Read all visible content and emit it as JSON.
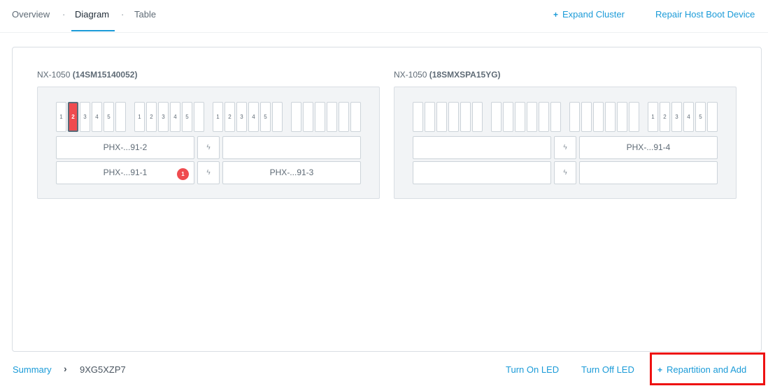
{
  "tabs": [
    {
      "label": "Overview",
      "active": false
    },
    {
      "label": "Diagram",
      "active": true
    },
    {
      "label": "Table",
      "active": false
    }
  ],
  "tab_separator": "·",
  "header_actions": {
    "expand_cluster_icon": "+",
    "expand_cluster": "Expand Cluster",
    "repair_host_boot": "Repair Host Boot Device"
  },
  "blocks": [
    {
      "model": "NX-1050",
      "serial": "(14SM15140052)",
      "disk_groups": [
        [
          "1",
          "2",
          "3",
          "4",
          "5",
          ""
        ],
        [
          "1",
          "2",
          "3",
          "4",
          "5",
          ""
        ],
        [
          "1",
          "2",
          "3",
          "4",
          "5",
          ""
        ],
        [
          "",
          "",
          "",
          "",
          "",
          ""
        ]
      ],
      "alert_disk": "2",
      "power_icon": "ϟ",
      "nodes": {
        "top_left": "PHX-...91-2",
        "top_right": "",
        "bottom_left": "PHX-...91-1",
        "bottom_right": "PHX-...91-3"
      },
      "alert_count": "1"
    },
    {
      "model": "NX-1050",
      "serial": "(18SMXSPA15YG)",
      "disk_groups": [
        [
          "",
          "",
          "",
          "",
          "",
          ""
        ],
        [
          "",
          "",
          "",
          "",
          "",
          ""
        ],
        [
          "",
          "",
          "",
          "",
          "",
          ""
        ],
        [
          "1",
          "2",
          "3",
          "4",
          "5",
          ""
        ]
      ],
      "power_icon": "ϟ",
      "nodes": {
        "top_left": "",
        "top_right": "PHX-...91-4",
        "bottom_left": "",
        "bottom_right": ""
      }
    }
  ],
  "footer": {
    "breadcrumb_summary": "Summary",
    "breadcrumb_chevron": "›",
    "breadcrumb_current": "9XG5XZP7",
    "turn_on_led": "Turn On LED",
    "turn_off_led": "Turn Off LED",
    "repartition_icon": "+",
    "repartition_and_add": "Repartition and Add"
  },
  "colors": {
    "accent": "#1b9bd8",
    "alert": "#ef4b4f",
    "highlight": "#ee1111"
  }
}
